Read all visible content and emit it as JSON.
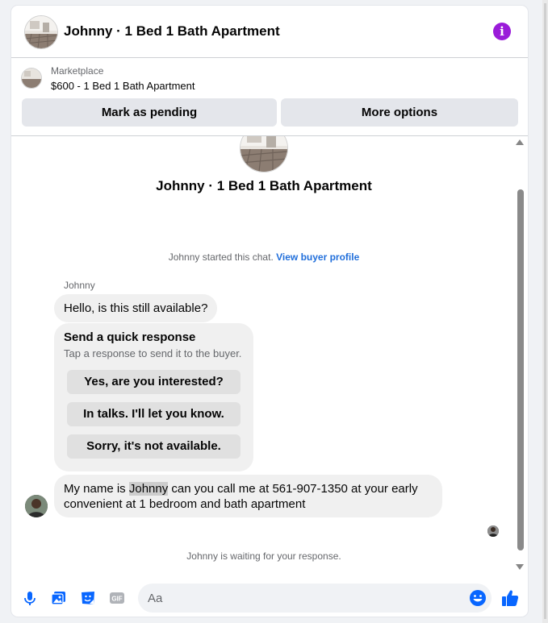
{
  "header": {
    "title": "Johnny · 1 Bed 1 Bath Apartment",
    "info_icon": "info-icon",
    "info_color": "#9a1bd9"
  },
  "listing": {
    "marketplace_label": "Marketplace",
    "listing_text": "$600 - 1 Bed 1 Bath Apartment",
    "mark_pending_label": "Mark as pending",
    "more_options_label": "More options"
  },
  "chat": {
    "center_title": "Johnny · 1 Bed 1 Bath Apartment",
    "started_text": "Johnny started this chat.",
    "view_profile_link": "View buyer profile",
    "sender_name": "Johnny",
    "message_1": "Hello, is this still available?",
    "quick_response": {
      "title": "Send a quick response",
      "subtitle": "Tap a response to send it to the buyer.",
      "options": [
        "Yes, are you interested?",
        "In talks. I'll let you know.",
        "Sorry, it's not available."
      ]
    },
    "message_2": {
      "before": "My name is ",
      "highlight": "Johnny",
      "after": " can you call me at 561-907-1350 at your early convenient at 1 bedroom and bath apartment"
    },
    "waiting_text": "Johnny is waiting for your response."
  },
  "composer": {
    "placeholder": "Aa",
    "icons": [
      "microphone-icon",
      "photo-icon",
      "sticker-icon",
      "gif-icon",
      "emoji-icon",
      "thumbs-up-icon"
    ],
    "accent_color": "#0866ff"
  }
}
